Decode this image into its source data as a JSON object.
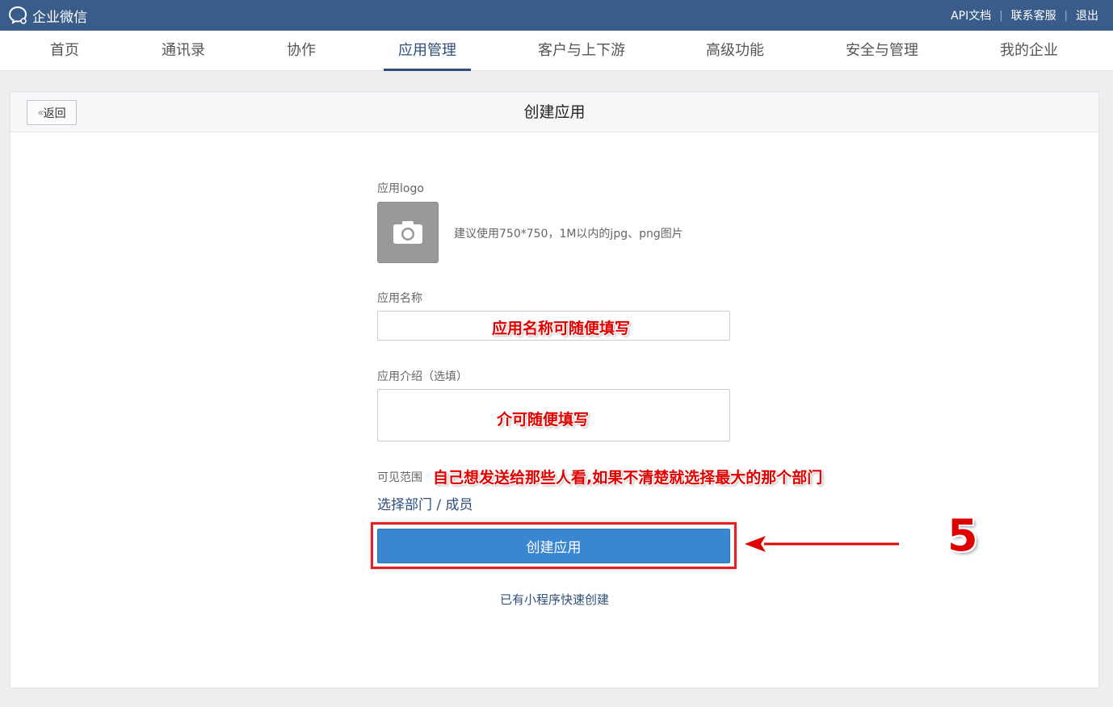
{
  "app": {
    "brand": "企业微信"
  },
  "top_links": {
    "api_docs": "API文档",
    "support": "联系客服",
    "logout": "退出"
  },
  "nav": {
    "items": [
      {
        "label": "首页"
      },
      {
        "label": "通讯录"
      },
      {
        "label": "协作"
      },
      {
        "label": "应用管理",
        "active": true
      },
      {
        "label": "客户与上下游"
      },
      {
        "label": "高级功能"
      },
      {
        "label": "安全与管理"
      },
      {
        "label": "我的企业"
      }
    ]
  },
  "page": {
    "back_label": "返回",
    "title": "创建应用"
  },
  "form": {
    "logo_label": "应用logo",
    "logo_hint": "建议使用750*750，1M以内的jpg、png图片",
    "name_label": "应用名称",
    "name_value": "",
    "desc_label": "应用介绍（选填）",
    "desc_value": "",
    "visibility_label": "可见范围",
    "select_members": "选择部门 / 成员",
    "create_button": "创建应用",
    "quick_create": "已有小程序快速创建"
  },
  "annotations": {
    "name_note": "应用名称可随便填写",
    "desc_note": "介可随便填写",
    "visibility_note": "自己想发送给那些人看,如果不清楚就选择最大的那个部门",
    "step_number": "5",
    "color": "#e10000"
  },
  "colors": {
    "topbar": "#3a5c8a",
    "accent": "#2f4f7a",
    "button": "#3b86d0",
    "highlight": "#e32026"
  }
}
